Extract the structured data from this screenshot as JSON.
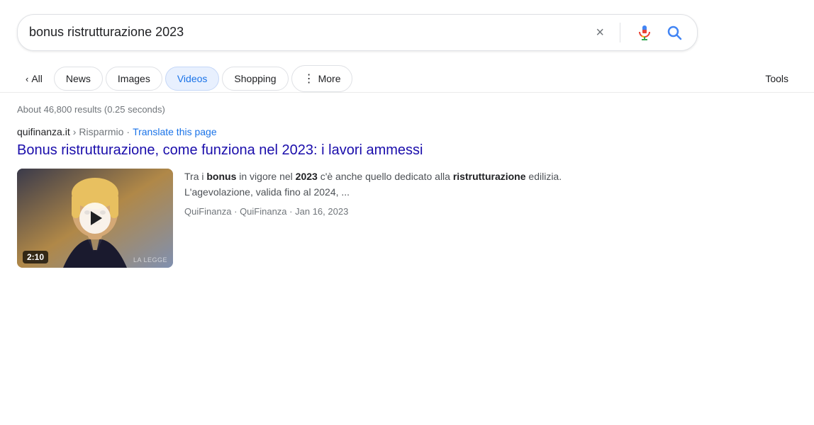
{
  "search": {
    "query": "bonus ristrutturazione 2023",
    "clear_label": "×",
    "voice_label": "voice search",
    "submit_label": "search"
  },
  "tabs": {
    "all_label": "All",
    "items": [
      {
        "id": "news",
        "label": "News",
        "active": false
      },
      {
        "id": "images",
        "label": "Images",
        "active": false
      },
      {
        "id": "videos",
        "label": "Videos",
        "active": true
      },
      {
        "id": "shopping",
        "label": "Shopping",
        "active": false
      }
    ],
    "more_label": "More",
    "tools_label": "Tools"
  },
  "results": {
    "stats": "About 46,800 results (0.25 seconds)",
    "items": [
      {
        "site": "quifinanza.it",
        "breadcrumb_separator": "›",
        "breadcrumb_path": "Risparmio",
        "translate_label": "Translate this page",
        "title": "Bonus ristrutturazione, come funziona nel 2023: i lavori ammessi",
        "snippet_html": "Tra i <b>bonus</b> in vigore nel <b>2023</b> c'è anche quello dedicato alla <b>ristrutturazione</b> edilizia. L'agevolazione, valida fino al 2024, ...",
        "source_name": "QuiFinanza",
        "source_repeat": "QuiFinanza",
        "date": "Jan 16, 2023",
        "video_duration": "2:10",
        "video_watermark": "LA LEGGE"
      }
    ]
  }
}
